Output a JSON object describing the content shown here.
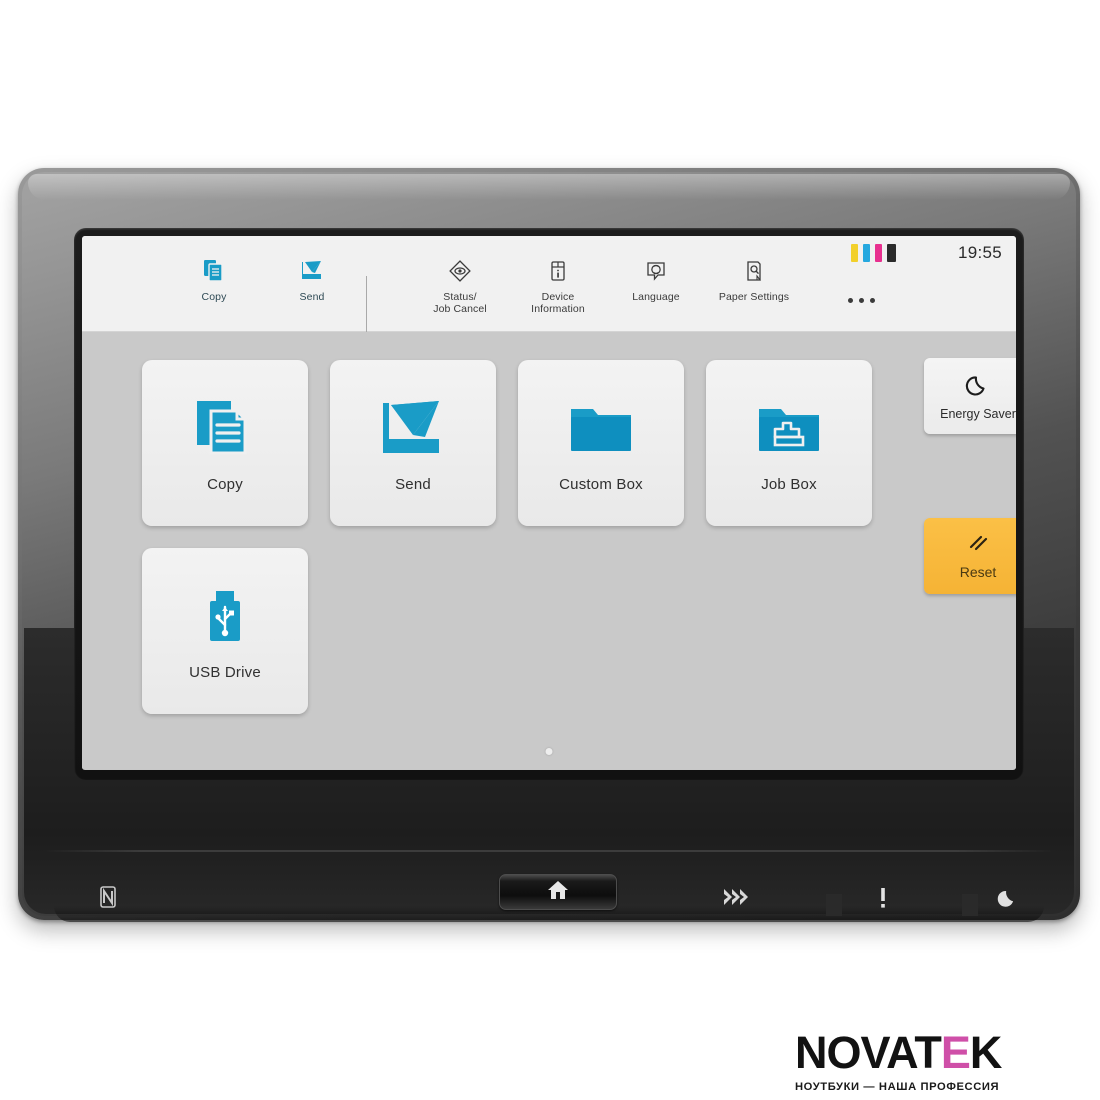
{
  "device": {
    "name": "printer-control-panel",
    "bezel_color": "#3d3d3d",
    "body_color": "#242424"
  },
  "status_bar": {
    "clock": "19:55",
    "toner": [
      {
        "name": "yellow",
        "color": "#f2d02b",
        "level": 100
      },
      {
        "name": "cyan",
        "color": "#25a8df",
        "level": 100
      },
      {
        "name": "magenta",
        "color": "#e8308f",
        "level": 100
      },
      {
        "name": "black",
        "color": "#2b2b2b",
        "level": 100
      }
    ]
  },
  "toolbar": {
    "items": [
      {
        "label": "Copy",
        "icon": "copy-icon",
        "accent": true
      },
      {
        "label": "Send",
        "icon": "send-icon",
        "accent": true
      },
      {
        "label": "Status/\nJob Cancel",
        "line1": "Status/",
        "line2": "Job Cancel",
        "icon": "status-job-cancel-icon",
        "accent": false
      },
      {
        "label": "Device Information",
        "line1": "Device",
        "line2": "Information",
        "icon": "device-information-icon",
        "accent": false
      },
      {
        "label": "Language",
        "line1": "Language",
        "line2": "",
        "icon": "language-icon",
        "accent": false
      },
      {
        "label": "Paper Settings",
        "line1": "Paper Settings",
        "line2": "",
        "icon": "paper-settings-icon",
        "accent": false
      }
    ],
    "more_label": "•••"
  },
  "home": {
    "tiles": [
      {
        "label": "Copy",
        "icon": "copy-tile-icon"
      },
      {
        "label": "Send",
        "icon": "send-tile-icon"
      },
      {
        "label": "Custom Box",
        "icon": "custom-box-folder-icon"
      },
      {
        "label": "Job Box",
        "icon": "job-box-folder-icon"
      },
      {
        "label": "USB Drive",
        "icon": "usb-drive-icon"
      }
    ],
    "side_buttons": [
      {
        "label": "Energy Saver",
        "icon": "moon-icon",
        "style": "light"
      },
      {
        "label": "Reset",
        "icon": "reset-slashes-icon",
        "style": "amber"
      }
    ],
    "accent_color": "#1a9cc7",
    "reset_color": "#f7ba3c"
  },
  "hardware": {
    "nfc_icon": "nfc-icon",
    "home_button_icon": "home-icon",
    "indicators": [
      {
        "name": "data-transfer-icon",
        "glyph": "⋙"
      },
      {
        "name": "attention-icon",
        "glyph": "!"
      },
      {
        "name": "energy-saver-led-icon",
        "glyph": "moon"
      }
    ]
  },
  "watermark": {
    "brand_part1": "NOVAT",
    "brand_e": "E",
    "brand_part2": "K",
    "tagline": "НОУТБУКИ — НАША ПРОФЕССИЯ",
    "accent_color": "#cf4fa8"
  }
}
